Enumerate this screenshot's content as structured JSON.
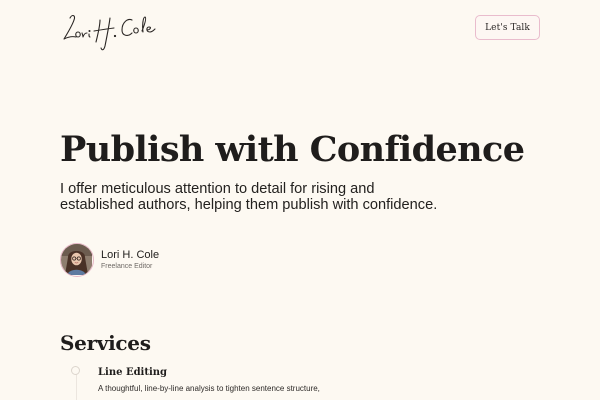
{
  "header": {
    "logo_text": "Lori H. Cole",
    "cta_label": "Let's Talk"
  },
  "hero": {
    "title": "Publish with Confidence",
    "subtitle": "I offer meticulous attention to detail for rising and established authors, helping them publish with confidence."
  },
  "author": {
    "name": "Lori H. Cole",
    "role": "Freelance Editor"
  },
  "services": {
    "heading": "Services",
    "items": [
      {
        "title": "Line Editing",
        "description": "A thoughtful, line-by-line analysis to tighten sentence structure,"
      }
    ]
  },
  "colors": {
    "background": "#fdf9f2",
    "accent_border": "#e9bccd",
    "text": "#1f1d1c"
  },
  "icons": {
    "logo": "signature-logo",
    "timeline_marker": "circle-icon"
  }
}
